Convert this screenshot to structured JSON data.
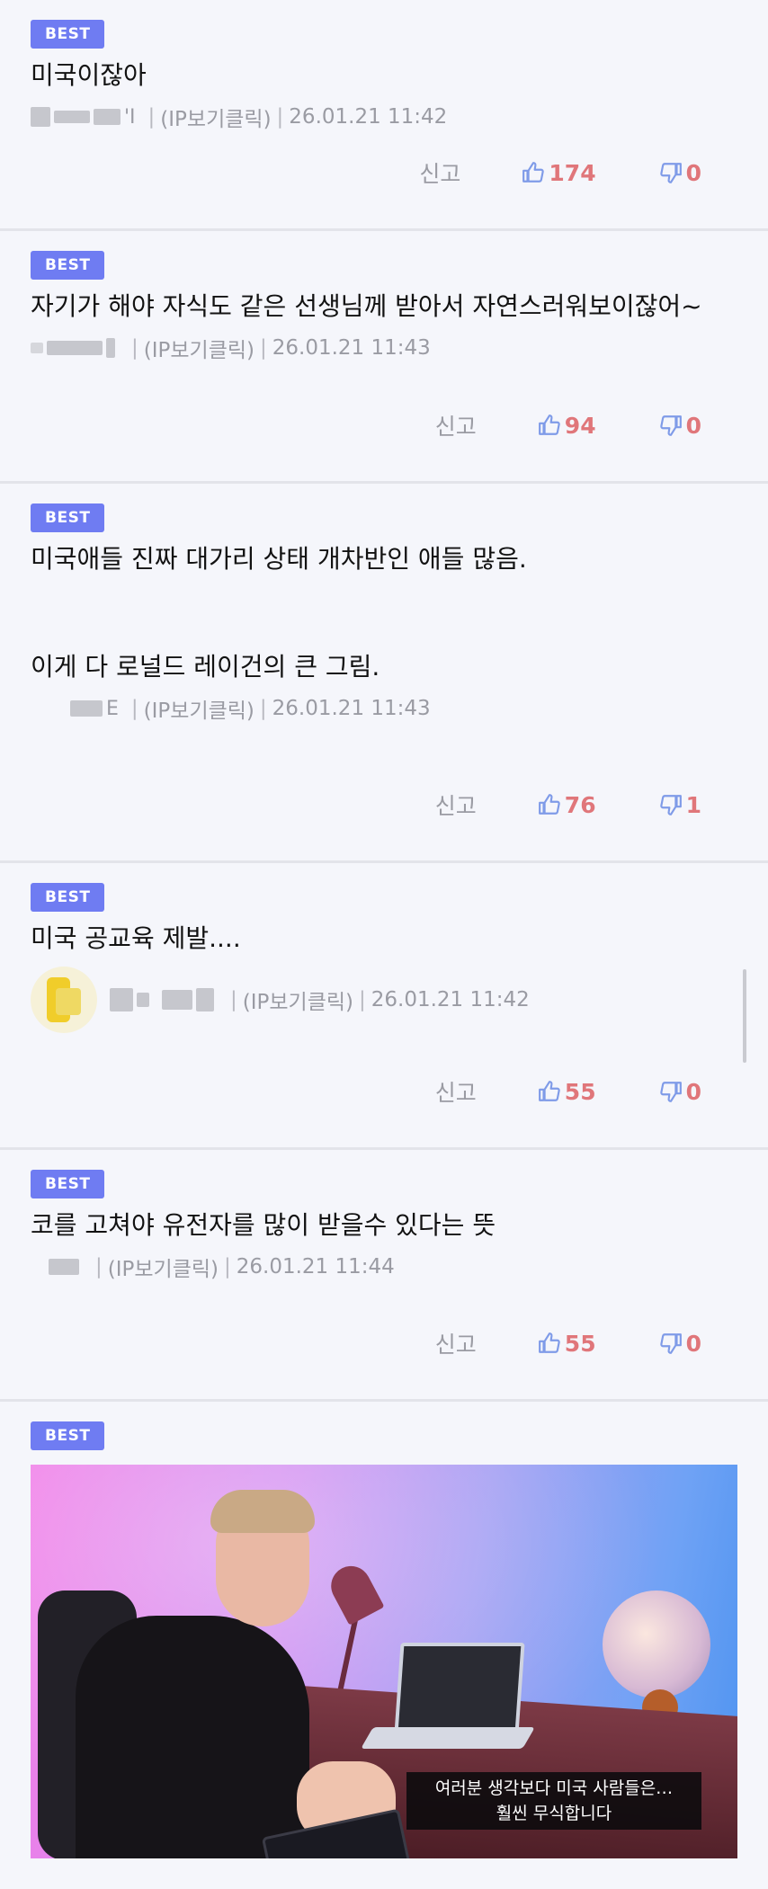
{
  "common": {
    "badge": "BEST",
    "ip_label": "(IP보기클릭)",
    "report_label": "신고"
  },
  "comments": [
    {
      "text": "미국이잖아",
      "author_fragment": "'I",
      "timestamp": "26.01.21 11:42",
      "likes": "174",
      "dislikes": "0"
    },
    {
      "text": "자기가 해야 자식도 같은 선생님께 받아서 자연스러워보이잖어~",
      "author_fragment": "",
      "timestamp": "26.01.21 11:43",
      "likes": "94",
      "dislikes": "0"
    },
    {
      "text": "미국애들 진짜 대가리 상태 개차반인 애들 많음.\n\n\n이게 다 로널드 레이건의 큰 그림.",
      "author_fragment": "E",
      "timestamp": "26.01.21 11:43",
      "likes": "76",
      "dislikes": "1"
    },
    {
      "text": "미국 공교육 제발....",
      "author_fragment": "",
      "timestamp": "26.01.21 11:42",
      "likes": "55",
      "dislikes": "0"
    },
    {
      "text": "코를 고쳐야 유전자를 많이 받을수 있다는 뜻",
      "author_fragment": "",
      "timestamp": "26.01.21 11:44",
      "likes": "55",
      "dislikes": "0"
    }
  ],
  "image_comment": {
    "subtitle_line1": "여러분 생각보다 미국 사람들은…",
    "subtitle_line2": "훨씬 무식합니다"
  },
  "icons": {
    "like": "thumbs-up-icon",
    "dislike": "thumbs-down-icon"
  },
  "colors": {
    "badge": "#6f7cf2",
    "count": "#e0767a",
    "meta": "#9a9ba3"
  }
}
